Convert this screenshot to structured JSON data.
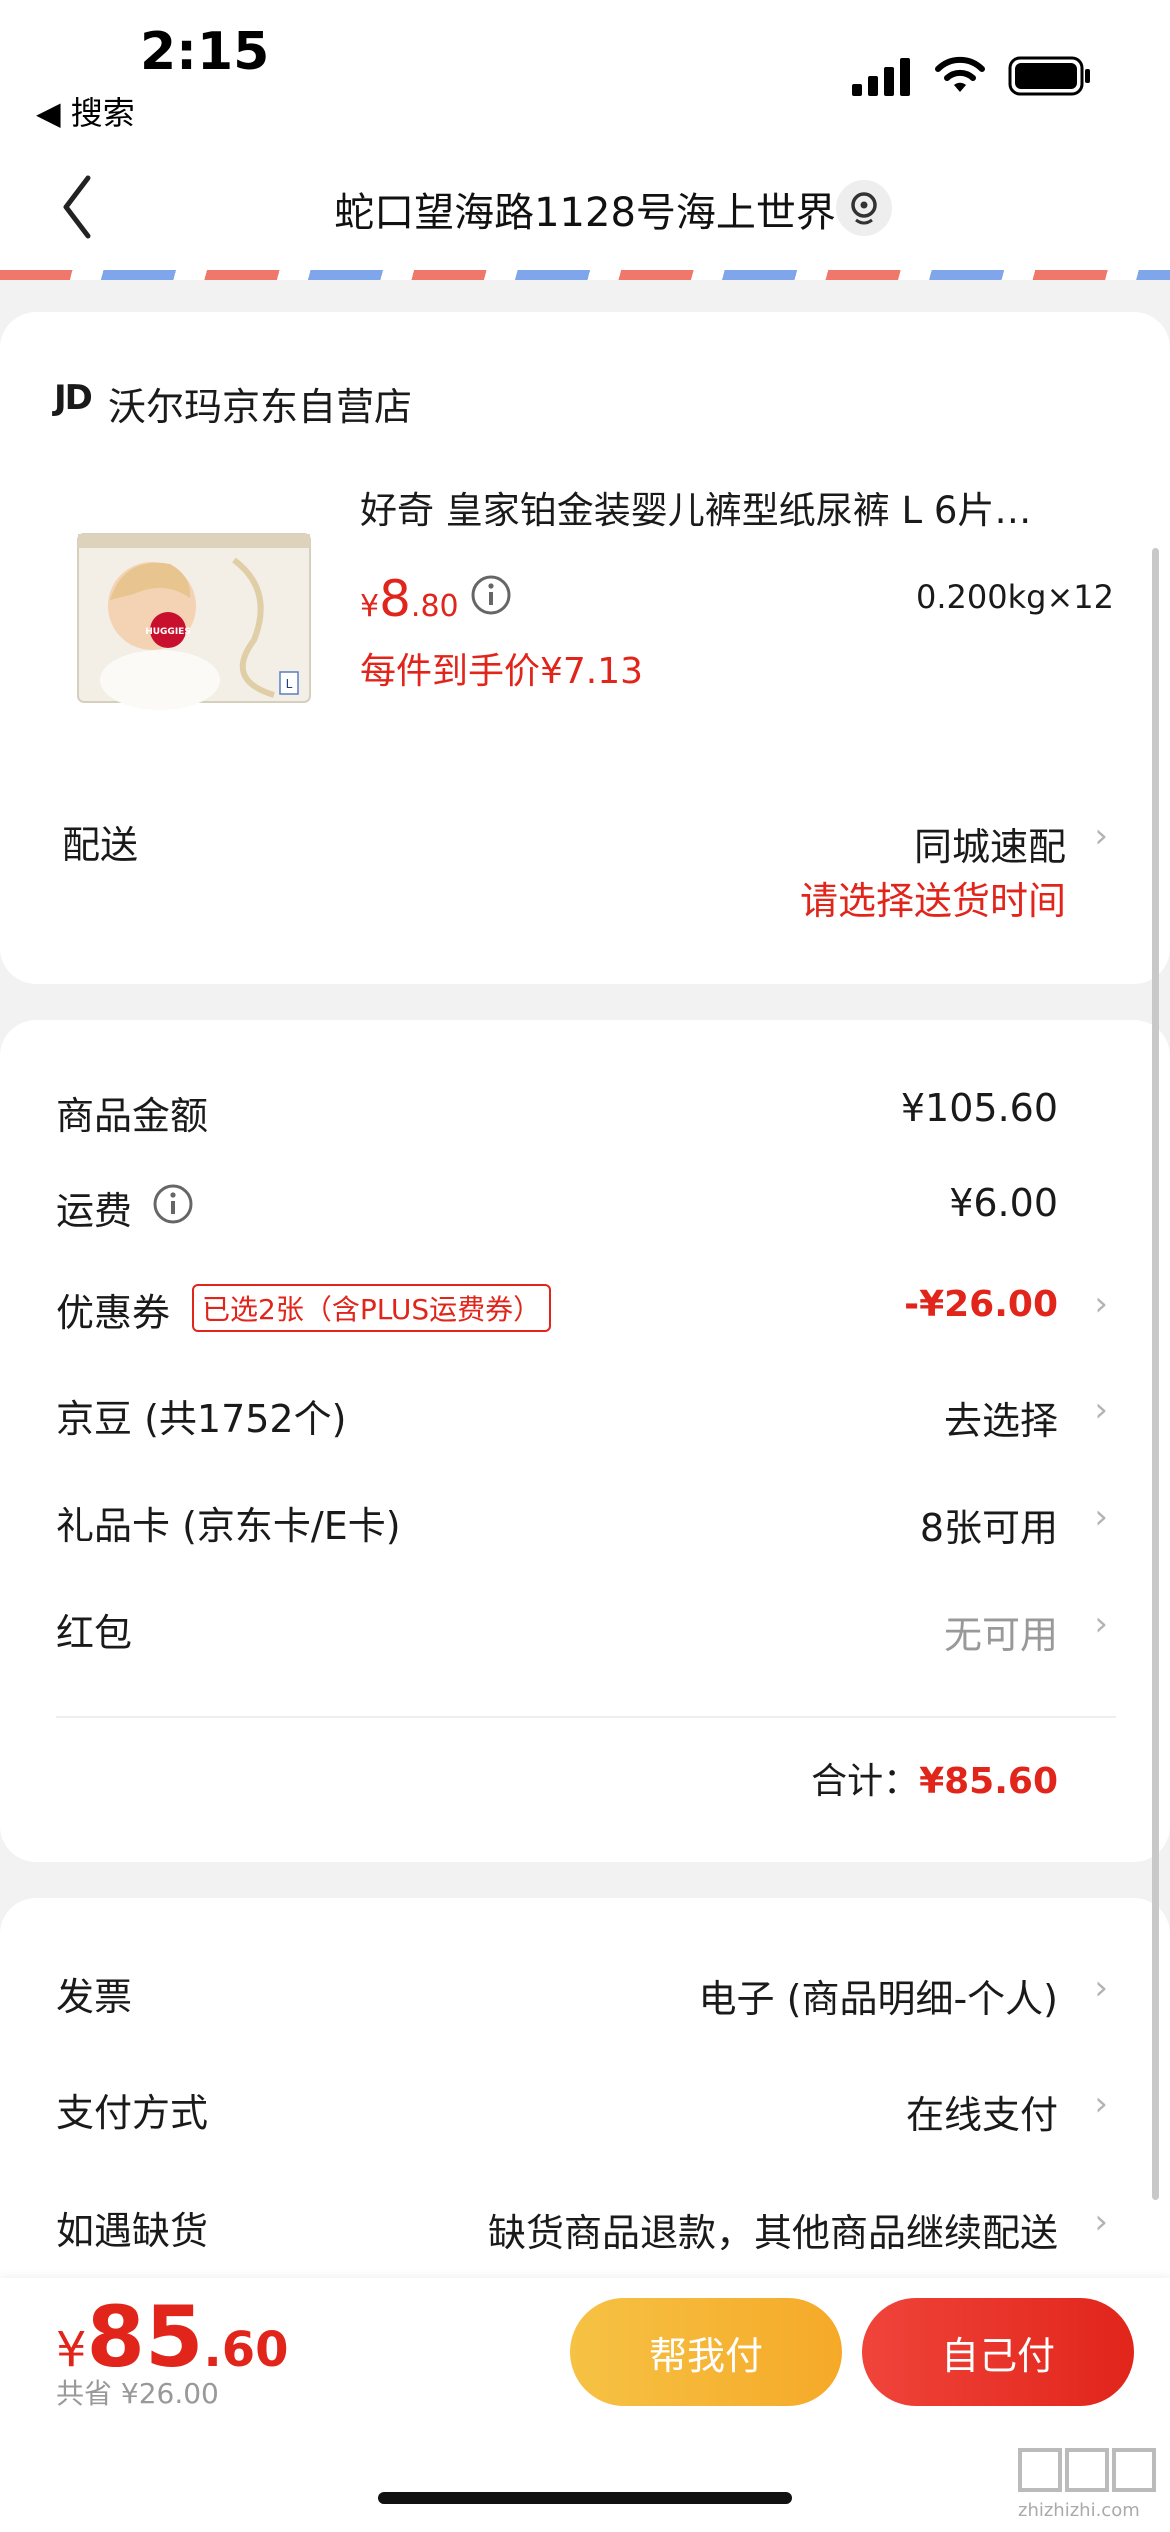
{
  "status": {
    "time": "2:15",
    "back_app": "◀ 搜索"
  },
  "header": {
    "address": "蛇口望海路1128号海上世界"
  },
  "store": {
    "logo": "JD",
    "name": "沃尔玛京东自营店"
  },
  "product": {
    "title": "好奇 皇家铂金装婴儿裤型纸尿裤 L  6片…",
    "price_symbol": "¥",
    "price_int": "8",
    "price_dec": ".80",
    "spec": "0.200kg×12",
    "unit_price": "每件到手价¥7.13",
    "image_brand": "HUGGIES",
    "image_size": "L"
  },
  "delivery": {
    "label": "配送",
    "value": "同城速配",
    "hint": "请选择送货时间"
  },
  "summary": {
    "goods_amount": {
      "label": "商品金额",
      "value": "¥105.60"
    },
    "freight": {
      "label": "运费",
      "value": "¥6.00"
    },
    "coupon": {
      "label": "优惠券",
      "tag": "已选2张（含PLUS运费券）",
      "value": "-¥26.00"
    },
    "jingdou": {
      "label": "京豆 (共1752个)",
      "value": "去选择"
    },
    "giftcard": {
      "label": "礼品卡 (京东卡/E卡)",
      "value": "8张可用"
    },
    "redpacket": {
      "label": "红包",
      "value": "无可用"
    },
    "total_label": "合计：",
    "total_value": "¥85.60"
  },
  "extra": {
    "invoice": {
      "label": "发票",
      "value": "电子 (商品明细-个人)"
    },
    "payment": {
      "label": "支付方式",
      "value": "在线支付"
    },
    "stockout": {
      "label": "如遇缺货",
      "value": "缺货商品退款，其他商品继续配送"
    }
  },
  "bottom": {
    "symbol": "¥",
    "int": "85",
    "dec": ".60",
    "saved": "共省 ¥26.00",
    "help_pay": "帮我付",
    "self_pay": "自己付"
  },
  "watermark": {
    "site": "zhizhizhi.com"
  },
  "colors": {
    "accent": "#e1251b",
    "orange": "#f5a623"
  }
}
